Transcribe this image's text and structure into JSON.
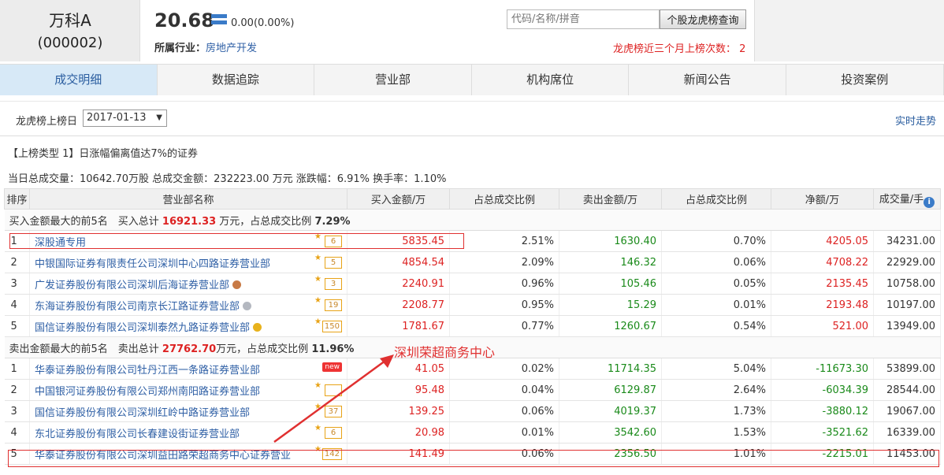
{
  "stock": {
    "name": "万科A",
    "code": "(000002)",
    "price": "20.68",
    "change": "0.00(0.00%)"
  },
  "industry": {
    "label": "所属行业：",
    "value": "房地产开发"
  },
  "search": {
    "placeholder": "代码/名称/拼音",
    "button": "个股龙虎榜查询"
  },
  "count_text": "龙虎榜近三个月上榜次数： 2",
  "tabs": [
    "成交明细",
    "数据追踪",
    "营业部",
    "机构席位",
    "新闻公告",
    "投资案例"
  ],
  "toolbar": {
    "date_label": "龙虎榜上榜日",
    "date_value": "2017-01-13",
    "realtime": "实时走势"
  },
  "type_line": "【上榜类型 1】日涨幅偏离值达7%的证券",
  "summary": "当日总成交量：10642.70万股 总成交金额：232223.00 万元 涨跌幅：6.91% 换手率：1.10%",
  "columns": [
    "排序",
    "营业部名称",
    "买入金额/万",
    "占总成交比例",
    "卖出金额/万",
    "占总成交比例",
    "净额/万",
    "成交量/手"
  ],
  "buy_group": {
    "prefix": "买入金额最大的前5名　买入总计 ",
    "total": "16921.33",
    "mid": " 万元，占总成交比例 ",
    "ratio": "7.29%"
  },
  "sell_group": {
    "prefix": "卖出金额最大的前5名　卖出总计 ",
    "total": "27762.70",
    "mid": "万元，占总成交比例 ",
    "ratio": "11.96%"
  },
  "buy_rows": [
    {
      "rank": "1",
      "name": "深股通专用",
      "badge": "6",
      "buy": "5835.45",
      "buy_ratio": "2.51%",
      "sell": "1630.40",
      "sell_ratio": "0.70%",
      "net": "4205.05",
      "vol": "34231.00"
    },
    {
      "rank": "2",
      "name": "中银国际证券有限责任公司深圳中心四路证券营业部",
      "badge": "5",
      "buy": "4854.54",
      "buy_ratio": "2.09%",
      "sell": "146.32",
      "sell_ratio": "0.06%",
      "net": "4708.22",
      "vol": "22929.00"
    },
    {
      "rank": "3",
      "name": "广发证券股份有限公司深圳后海证券营业部",
      "badge": "3",
      "medal": "bronze",
      "buy": "2240.91",
      "buy_ratio": "0.96%",
      "sell": "105.46",
      "sell_ratio": "0.05%",
      "net": "2135.45",
      "vol": "10758.00"
    },
    {
      "rank": "4",
      "name": "东海证券股份有限公司南京长江路证券营业部",
      "badge": "19",
      "medal": "silver",
      "buy": "2208.77",
      "buy_ratio": "0.95%",
      "sell": "15.29",
      "sell_ratio": "0.01%",
      "net": "2193.48",
      "vol": "10197.00"
    },
    {
      "rank": "5",
      "name": "国信证券股份有限公司深圳泰然九路证券营业部",
      "badge": "150",
      "medal": "gold",
      "buy": "1781.67",
      "buy_ratio": "0.77%",
      "sell": "1260.67",
      "sell_ratio": "0.54%",
      "net": "521.00",
      "vol": "13949.00"
    }
  ],
  "sell_rows": [
    {
      "rank": "1",
      "name": "华泰证券股份有限公司牡丹江西一条路证券营业部",
      "badge": "new",
      "buy": "41.05",
      "buy_ratio": "0.02%",
      "sell": "11714.35",
      "sell_ratio": "5.04%",
      "net": "-11673.30",
      "vol": "53899.00"
    },
    {
      "rank": "2",
      "name": "中国银河证券股份有限公司郑州南阳路证券营业部",
      "badge": "",
      "buy": "95.48",
      "buy_ratio": "0.04%",
      "sell": "6129.87",
      "sell_ratio": "2.64%",
      "net": "-6034.39",
      "vol": "28544.00"
    },
    {
      "rank": "3",
      "name": "国信证券股份有限公司深圳红岭中路证券营业部",
      "badge": "37",
      "buy": "139.25",
      "buy_ratio": "0.06%",
      "sell": "4019.37",
      "sell_ratio": "1.73%",
      "net": "-3880.12",
      "vol": "19067.00"
    },
    {
      "rank": "4",
      "name": "东北证券股份有限公司长春建设街证券营业部",
      "badge": "6",
      "buy": "20.98",
      "buy_ratio": "0.01%",
      "sell": "3542.60",
      "sell_ratio": "1.53%",
      "net": "-3521.62",
      "vol": "16339.00"
    },
    {
      "rank": "5",
      "name": "华泰证券股份有限公司深圳益田路荣超商务中心证券营业",
      "badge": "142",
      "buy": "141.49",
      "buy_ratio": "0.06%",
      "sell": "2356.50",
      "sell_ratio": "1.01%",
      "net": "-2215.01",
      "vol": "11453.00"
    }
  ],
  "annotation": "深圳荣超商务中心",
  "colors": {
    "accent": "#2a5d9f",
    "up": "#d22",
    "down": "#1a8a1a",
    "annot": "#e03030"
  }
}
